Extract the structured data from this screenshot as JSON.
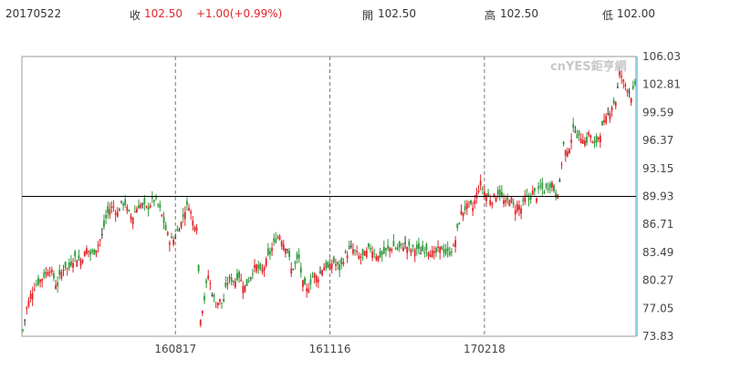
{
  "header": {
    "date": "20170522",
    "close_label": "收",
    "close_value": "102.50",
    "change": "+1.00(+0.99%)",
    "open_label": "開",
    "open_value": "102.50",
    "high_label": "高",
    "high_value": "102.50",
    "low_label": "低",
    "low_value": "102.00"
  },
  "watermark": "cnYES鉅亨網",
  "colors": {
    "up": "#e0262b",
    "down": "#2e9a3a",
    "flat": "#333333",
    "refline": "#000000",
    "right_axis": "#8fcde6",
    "dashed_grid": "#777777"
  },
  "chart_data": {
    "type": "candlestick",
    "title": "",
    "xlabel": "",
    "ylabel": "",
    "ylim": [
      73.83,
      106.03
    ],
    "yticks": [
      "106.03",
      "102.81",
      "99.59",
      "96.37",
      "93.15",
      "89.93",
      "86.71",
      "83.49",
      "80.27",
      "77.05",
      "73.83"
    ],
    "xticks": [
      {
        "label": "160817",
        "index": 79
      },
      {
        "label": "161116",
        "index": 159
      },
      {
        "label": "170218",
        "index": 239
      }
    ],
    "reference_line": 89.93,
    "count": 318,
    "closes": [
      74.5,
      77.0,
      78.5,
      79.5,
      80.0,
      80.5,
      81.0,
      81.8,
      80.8,
      79.5,
      81.0,
      82.0,
      81.5,
      82.5,
      83.0,
      82.5,
      83.0,
      84.0,
      83.2,
      83.6,
      84.5,
      85.5,
      87.5,
      88.5,
      88.8,
      88.0,
      89.0,
      89.2,
      88.0,
      87.5,
      88.5,
      89.0,
      88.8,
      88.5,
      89.3,
      89.6,
      88.7,
      87.5,
      85.8,
      84.8,
      85.0,
      86.0,
      87.0,
      88.5,
      89.0,
      87.0,
      86.7,
      76.0,
      78.0,
      81.0,
      79.0,
      77.5,
      78.0,
      77.5,
      80.0,
      80.5,
      80.0,
      81.0,
      80.0,
      79.5,
      80.5,
      81.5,
      82.0,
      81.0,
      82.0,
      83.0,
      84.0,
      85.0,
      85.5,
      84.5,
      84.0,
      81.5,
      82.0,
      83.0,
      80.0,
      79.0,
      80.0,
      81.0,
      80.5,
      81.5,
      82.0,
      81.5,
      82.5,
      82.0,
      81.5,
      83.0,
      83.5,
      84.0,
      83.5,
      83.0,
      83.0,
      83.5,
      84.0,
      83.5,
      83.0,
      83.2,
      83.5,
      84.0,
      84.2,
      83.8,
      84.0,
      84.5,
      84.0,
      83.8,
      84.0,
      83.5,
      83.7,
      84.0,
      83.5,
      83.2,
      83.8,
      84.0,
      83.3,
      83.5,
      84.0,
      86.0,
      88.0,
      88.5,
      89.0,
      88.5,
      90.0,
      91.5,
      90.5,
      90.0,
      89.5,
      90.0,
      90.5,
      89.5,
      89.0,
      90.0,
      88.5,
      89.0,
      88.5,
      90.0,
      89.5,
      90.5,
      90.0,
      91.0,
      90.5,
      91.0,
      91.5,
      90.0,
      91.0,
      96.0,
      94.5,
      96.5,
      98.0,
      96.5,
      97.0,
      96.0,
      97.5,
      95.5,
      96.5,
      97.5,
      98.5,
      99.5,
      100.5,
      101.0,
      104.5,
      103.0,
      102.5,
      101.5,
      102.5
    ],
    "closes_index_offset": 0
  }
}
